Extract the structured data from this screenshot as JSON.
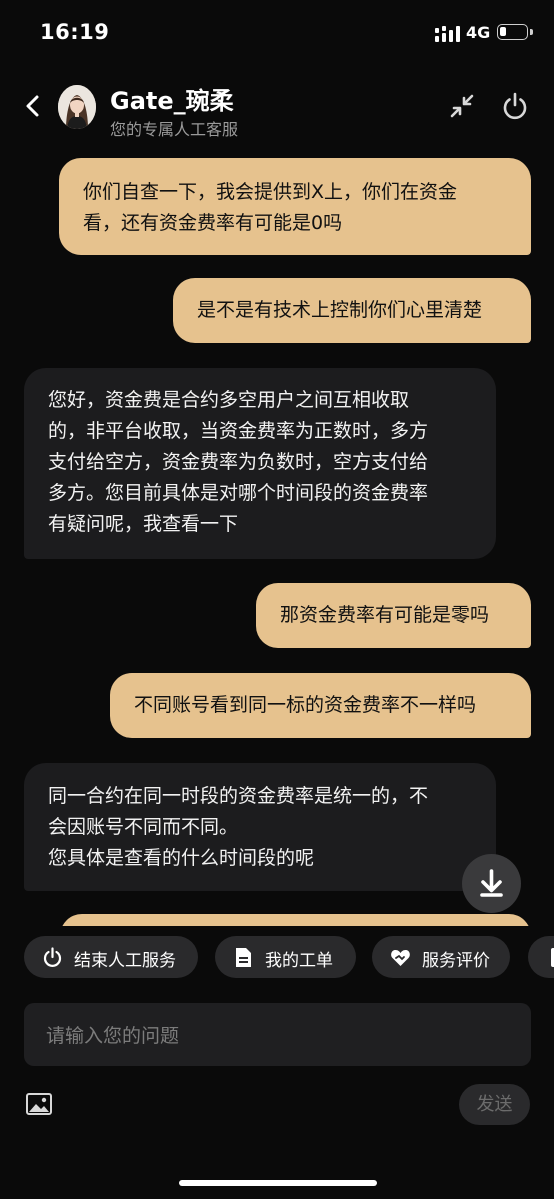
{
  "status_bar": {
    "time": "16:19",
    "network": "4G",
    "battery_level": 0.25
  },
  "header": {
    "agent_name": "Gate_琬柔",
    "subtitle": "您的专属人工客服"
  },
  "messages": [
    {
      "side": "out",
      "lines": [
        "你们自查一下，我会提供到X上，你们在资金",
        "看，还有资金费率有可能是0吗"
      ]
    },
    {
      "side": "out",
      "lines": [
        "是不是有技术上控制你们心里清楚"
      ]
    },
    {
      "side": "in",
      "lines": [
        "您好，资金费是合约多空用户之间互相收取",
        "的，非平台收取，当资金费率为正数时，多方",
        "支付给空方，资金费率为负数时，空方支付给",
        "多方。您目前具体是对哪个时间段的资金费率",
        "有疑问呢，我查看一下"
      ]
    },
    {
      "side": "out",
      "lines": [
        "那资金费率有可能是零吗"
      ]
    },
    {
      "side": "out",
      "lines": [
        "不同账号看到同一标的资金费率不一样吗"
      ]
    },
    {
      "side": "in",
      "lines": [
        "同一合约在同一时段的资金费率是统一的，不",
        "会因账号不同而不同。",
        "您具体是查看的什么时间段的呢"
      ]
    }
  ],
  "quick_actions": [
    {
      "label": "结束人工服务",
      "icon": "power-icon"
    },
    {
      "label": "我的工单",
      "icon": "document-icon"
    },
    {
      "label": "服务评价",
      "icon": "heart-handshake-icon"
    }
  ],
  "composer": {
    "placeholder": "请输入您的问题",
    "send_label": "发送"
  },
  "colors": {
    "outgoing_bubble": "#e6c28e",
    "incoming_bubble": "#1c1c1e",
    "background": "#0a0a0a"
  }
}
